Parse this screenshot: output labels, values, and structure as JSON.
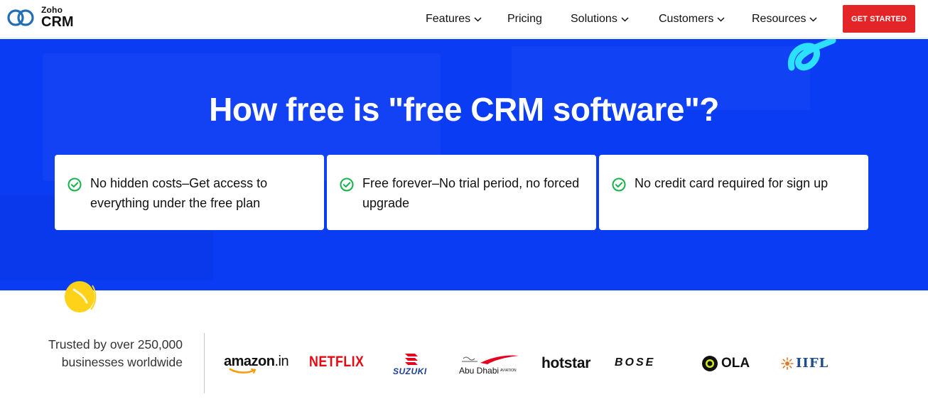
{
  "header": {
    "logo": {
      "brand": "Zoho",
      "product": "CRM"
    },
    "nav": [
      {
        "label": "Features",
        "has_dropdown": true
      },
      {
        "label": "Pricing",
        "has_dropdown": false
      },
      {
        "label": "Solutions",
        "has_dropdown": true
      },
      {
        "label": "Customers",
        "has_dropdown": true
      },
      {
        "label": "Resources",
        "has_dropdown": true
      }
    ],
    "cta_label": "GET STARTED"
  },
  "hero": {
    "title": "How free is \"free CRM software\"?",
    "cards": [
      {
        "icon": "check-circle-icon",
        "text": "No hidden costs–Get access to everything under the free plan"
      },
      {
        "icon": "check-circle-icon",
        "text": "Free forever–No trial period, no forced upgrade"
      },
      {
        "icon": "check-circle-icon",
        "text": "No credit card required for sign up"
      }
    ]
  },
  "trust": {
    "text": "Trusted by over 250,000 businesses worldwide",
    "brands": {
      "amazon": "amazon",
      "amazon_tld": ".in",
      "netflix": "NETFLIX",
      "suzuki": "SUZUKI",
      "abudhabi": "Abu Dhabi",
      "abudhabi_sub": "AVIATION",
      "hotstar": "hotstar",
      "bose": "BOSE",
      "ola": "OLA",
      "iifl": "IIFL"
    }
  },
  "colors": {
    "hero_bg": "#0a3cf4",
    "cta_bg": "#e42527",
    "check": "#14b34a",
    "netflix_red": "#e50914"
  }
}
